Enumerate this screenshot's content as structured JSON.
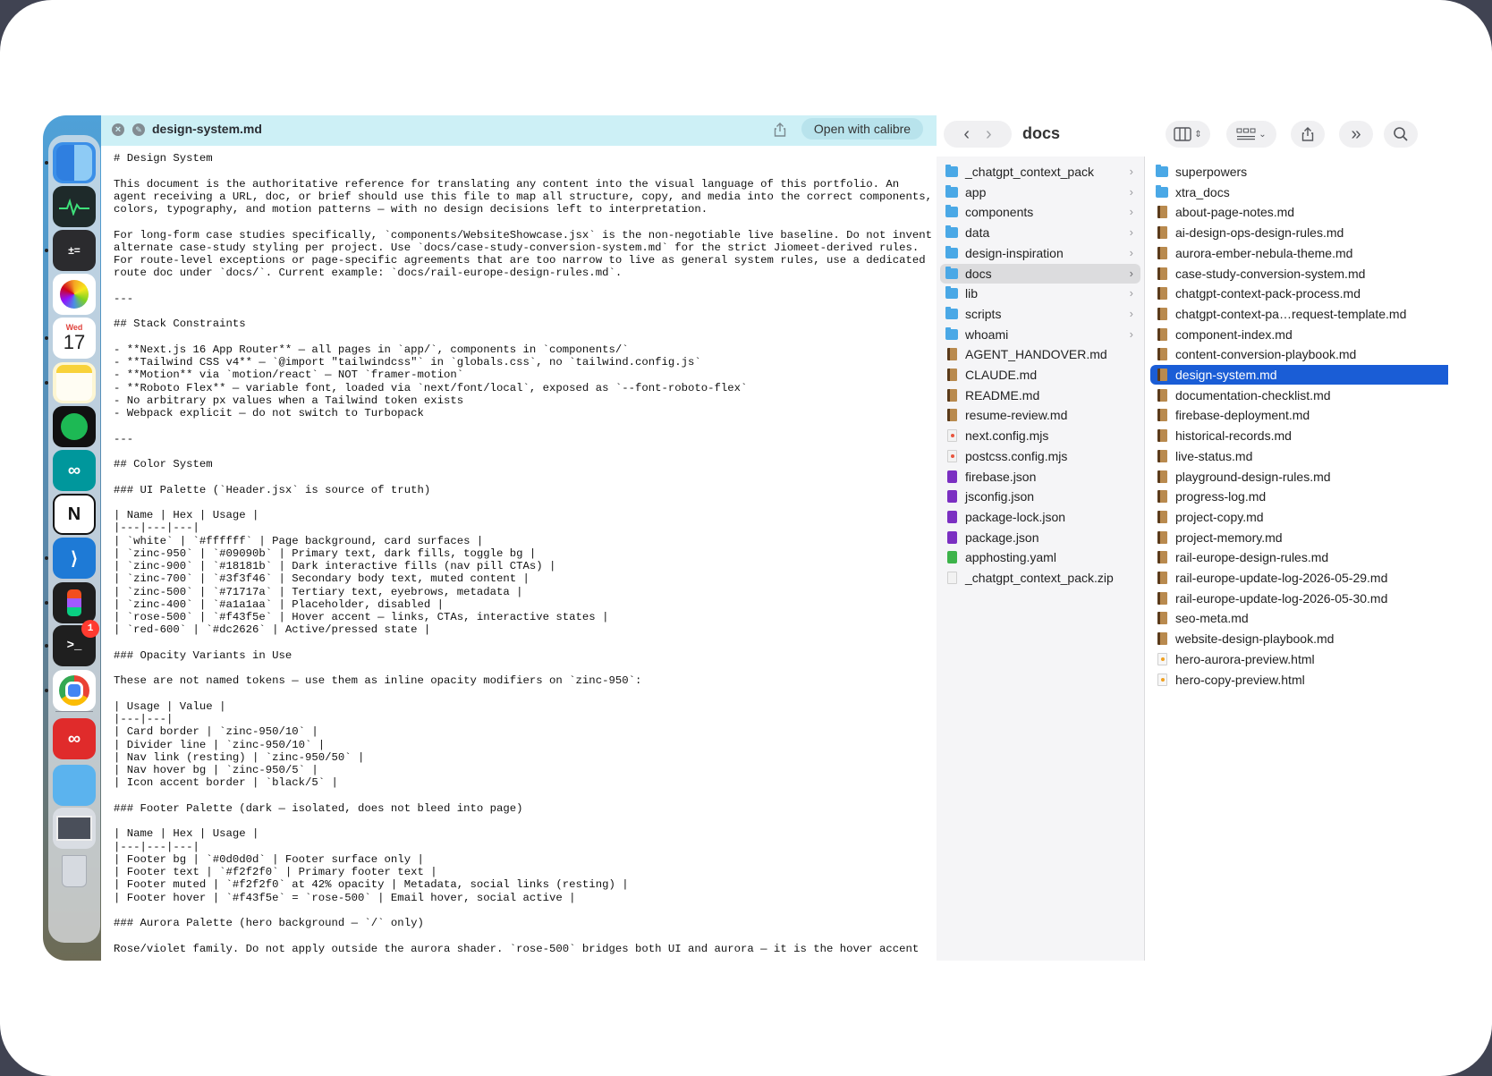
{
  "quicklook": {
    "filename": "design-system.md",
    "open_button": "Open with calibre",
    "content": "# Design System\n\nThis document is the authoritative reference for translating any content into the visual language of this portfolio. An\nagent receiving a URL, doc, or brief should use this file to map all structure, copy, and media into the correct components,\ncolors, typography, and motion patterns — with no design decisions left to interpretation.\n\nFor long-form case studies specifically, `components/WebsiteShowcase.jsx` is the non-negotiable live baseline. Do not invent\nalternate case-study styling per project. Use `docs/case-study-conversion-system.md` for the strict Jiomeet-derived rules.\nFor route-level exceptions or page-specific agreements that are too narrow to live as general system rules, use a dedicated\nroute doc under `docs/`. Current example: `docs/rail-europe-design-rules.md`.\n\n---\n\n## Stack Constraints\n\n- **Next.js 16 App Router** — all pages in `app/`, components in `components/`\n- **Tailwind CSS v4** — `@import \"tailwindcss\"` in `globals.css`, no `tailwind.config.js`\n- **Motion** via `motion/react` — NOT `framer-motion`\n- **Roboto Flex** — variable font, loaded via `next/font/local`, exposed as `--font-roboto-flex`\n- No arbitrary px values when a Tailwind token exists\n- Webpack explicit — do not switch to Turbopack\n\n---\n\n## Color System\n\n### UI Palette (`Header.jsx` is source of truth)\n\n| Name | Hex | Usage |\n|---|---|---|\n| `white` | `#ffffff` | Page background, card surfaces |\n| `zinc-950` | `#09090b` | Primary text, dark fills, toggle bg |\n| `zinc-900` | `#18181b` | Dark interactive fills (nav pill CTAs) |\n| `zinc-700` | `#3f3f46` | Secondary body text, muted content |\n| `zinc-500` | `#71717a` | Tertiary text, eyebrows, metadata |\n| `zinc-400` | `#a1a1aa` | Placeholder, disabled |\n| `rose-500` | `#f43f5e` | Hover accent — links, CTAs, interactive states |\n| `red-600` | `#dc2626` | Active/pressed state |\n\n### Opacity Variants in Use\n\nThese are not named tokens — use them as inline opacity modifiers on `zinc-950`:\n\n| Usage | Value |\n|---|---|\n| Card border | `zinc-950/10` |\n| Divider line | `zinc-950/10` |\n| Nav link (resting) | `zinc-950/50` |\n| Nav hover bg | `zinc-950/5` |\n| Icon accent border | `black/5` |\n\n### Footer Palette (dark — isolated, does not bleed into page)\n\n| Name | Hex | Usage |\n|---|---|---|\n| Footer bg | `#0d0d0d` | Footer surface only |\n| Footer text | `#f2f2f0` | Primary footer text |\n| Footer muted | `#f2f2f0` at 42% opacity | Metadata, social links (resting) |\n| Footer hover | `#f43f5e` = `rose-500` | Email hover, social active |\n\n### Aurora Palette (hero background — `/` only)\n\nRose/violet family. Do not apply outside the aurora shader. `rose-500` bridges both UI and aurora — it is the hover accent"
  },
  "finder": {
    "title": "docs",
    "col1": [
      {
        "name": "_chatgpt_context_pack",
        "type": "folder",
        "chevron": true
      },
      {
        "name": "app",
        "type": "folder",
        "chevron": true
      },
      {
        "name": "components",
        "type": "folder",
        "chevron": true
      },
      {
        "name": "data",
        "type": "folder",
        "chevron": true
      },
      {
        "name": "design-inspiration",
        "type": "folder",
        "chevron": true
      },
      {
        "name": "docs",
        "type": "folder",
        "chevron": true,
        "selected": true
      },
      {
        "name": "lib",
        "type": "folder",
        "chevron": true
      },
      {
        "name": "scripts",
        "type": "folder",
        "chevron": true
      },
      {
        "name": "whoami",
        "type": "folder",
        "chevron": true
      },
      {
        "name": "AGENT_HANDOVER.md",
        "type": "md"
      },
      {
        "name": "CLAUDE.md",
        "type": "md"
      },
      {
        "name": "README.md",
        "type": "md"
      },
      {
        "name": "resume-review.md",
        "type": "md"
      },
      {
        "name": "next.config.mjs",
        "type": "js"
      },
      {
        "name": "postcss.config.mjs",
        "type": "js"
      },
      {
        "name": "firebase.json",
        "type": "json"
      },
      {
        "name": "jsconfig.json",
        "type": "json"
      },
      {
        "name": "package-lock.json",
        "type": "json"
      },
      {
        "name": "package.json",
        "type": "json"
      },
      {
        "name": "apphosting.yaml",
        "type": "yaml"
      },
      {
        "name": "_chatgpt_context_pack.zip",
        "type": "zip"
      }
    ],
    "col2": [
      {
        "name": "superpowers",
        "type": "folder"
      },
      {
        "name": "xtra_docs",
        "type": "folder"
      },
      {
        "name": "about-page-notes.md",
        "type": "md"
      },
      {
        "name": "ai-design-ops-design-rules.md",
        "type": "md"
      },
      {
        "name": "aurora-ember-nebula-theme.md",
        "type": "md"
      },
      {
        "name": "case-study-conversion-system.md",
        "type": "md"
      },
      {
        "name": "chatgpt-context-pack-process.md",
        "type": "md"
      },
      {
        "name": "chatgpt-context-pa…request-template.md",
        "type": "md"
      },
      {
        "name": "component-index.md",
        "type": "md"
      },
      {
        "name": "content-conversion-playbook.md",
        "type": "md"
      },
      {
        "name": "design-system.md",
        "type": "md",
        "selected": true
      },
      {
        "name": "documentation-checklist.md",
        "type": "md"
      },
      {
        "name": "firebase-deployment.md",
        "type": "md"
      },
      {
        "name": "historical-records.md",
        "type": "md"
      },
      {
        "name": "live-status.md",
        "type": "md"
      },
      {
        "name": "playground-design-rules.md",
        "type": "md"
      },
      {
        "name": "progress-log.md",
        "type": "md"
      },
      {
        "name": "project-copy.md",
        "type": "md"
      },
      {
        "name": "project-memory.md",
        "type": "md"
      },
      {
        "name": "rail-europe-design-rules.md",
        "type": "md"
      },
      {
        "name": "rail-europe-update-log-2026-05-29.md",
        "type": "md"
      },
      {
        "name": "rail-europe-update-log-2026-05-30.md",
        "type": "md"
      },
      {
        "name": "seo-meta.md",
        "type": "md"
      },
      {
        "name": "website-design-playbook.md",
        "type": "md"
      },
      {
        "name": "hero-aurora-preview.html",
        "type": "html"
      },
      {
        "name": "hero-copy-preview.html",
        "type": "html"
      }
    ]
  },
  "dock": {
    "apps": [
      {
        "name": "finder",
        "icon": "finder-icon",
        "color": "#3b8fe8",
        "running": true
      },
      {
        "name": "activity-monitor",
        "icon": "activity-monitor-icon",
        "color": "#1e2a2a",
        "running": false
      },
      {
        "name": "calculator",
        "icon": "calculator-icon",
        "color": "#2b2b2e",
        "running": true
      },
      {
        "name": "photos",
        "icon": "photos-icon",
        "color": "#ffffff",
        "running": false
      },
      {
        "name": "calendar",
        "icon": "calendar-icon",
        "color": "#ffffff",
        "running": true,
        "month": "Wed",
        "day": "17"
      },
      {
        "name": "notes",
        "icon": "notes-icon",
        "color": "#fdf6d3",
        "running": true
      },
      {
        "name": "spotify",
        "icon": "spotify-icon",
        "color": "#1db954",
        "running": false
      },
      {
        "name": "arduino",
        "icon": "arduino-icon",
        "color": "#00979c",
        "running": false
      },
      {
        "name": "notion",
        "icon": "notion-icon",
        "color": "#ffffff",
        "running": false
      },
      {
        "name": "vscode",
        "icon": "vscode-icon",
        "color": "#1e7ad6",
        "running": true
      },
      {
        "name": "figma",
        "icon": "figma-icon",
        "color": "#1e1e1e",
        "running": true
      },
      {
        "name": "terminal",
        "icon": "terminal-icon",
        "color": "#1f1f1f",
        "running": true,
        "badge": "1"
      },
      {
        "name": "chrome",
        "icon": "chrome-icon",
        "color": "#ffffff",
        "running": true
      },
      {
        "name": "creative-cloud",
        "icon": "creative-cloud-icon",
        "color": "#e02b2b",
        "running": false
      },
      {
        "name": "downloads",
        "icon": "folder-icon",
        "color": "#5bb3ee",
        "running": false
      },
      {
        "name": "screenshot",
        "icon": "screenshot-icon",
        "color": "#d9dde3",
        "running": false
      },
      {
        "name": "trash",
        "icon": "trash-icon",
        "color": "#c8ccd2",
        "running": false
      }
    ]
  }
}
